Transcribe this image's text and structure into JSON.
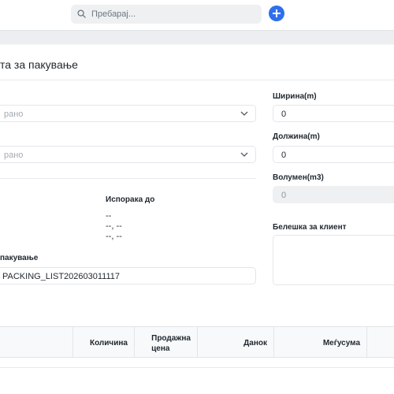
{
  "search": {
    "placeholder": "Пребарај..."
  },
  "form": {
    "title": "та за пакување",
    "select1": {
      "value": "рано"
    },
    "select2": {
      "value": "рано"
    },
    "width": {
      "label": "Ширина(m)",
      "value": "0"
    },
    "length": {
      "label": "Должина(m)",
      "value": "0"
    },
    "volume": {
      "label": "Волумен(m3)",
      "value": "0"
    },
    "client_note": {
      "label": "Белешка за клиент",
      "value": ""
    },
    "delivery_to": {
      "label": "Испорака до",
      "line1": "--",
      "line2": "--, --",
      "line3": "--, --"
    },
    "packing_list": {
      "label": "пакување",
      "value": "PACKING_LIST202603011117"
    }
  },
  "table": {
    "columns": [
      "Количина",
      "Продажна\nцена",
      "Данок",
      "Меѓусума"
    ]
  }
}
